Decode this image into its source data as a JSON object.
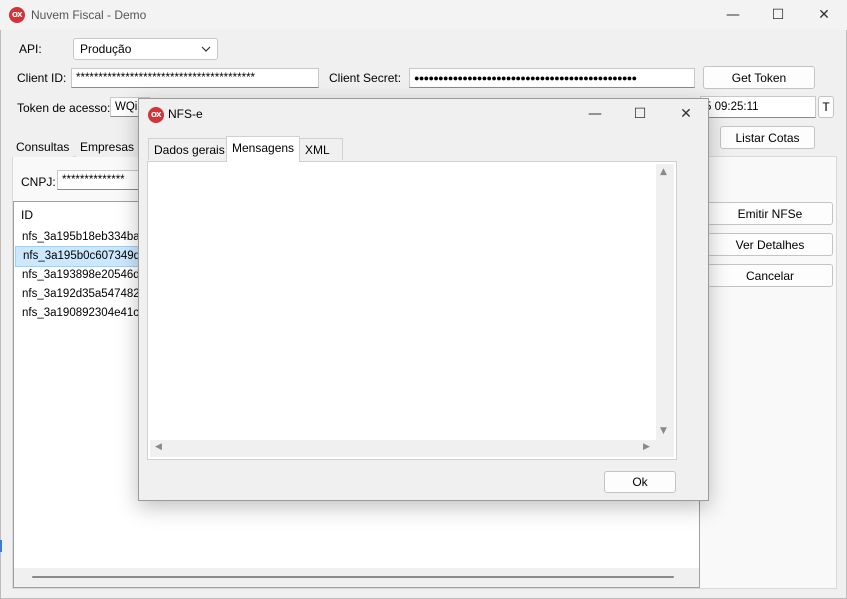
{
  "main_window": {
    "title": "Nuvem Fiscal - Demo",
    "app_icon": "OX",
    "controls": {
      "minimize": "—",
      "maximize": "☐",
      "close": "✕"
    }
  },
  "api": {
    "label": "API:",
    "selected": "Produção"
  },
  "credentials": {
    "client_id_label": "Client ID:",
    "client_id_value": "****************************************",
    "client_secret_label": "Client Secret:",
    "client_secret_value": "●●●●●●●●●●●●●●●●●●●●●●●●●●●●●●●●●●●●●●●●●●●●●●",
    "get_token_label": "Get Token"
  },
  "token": {
    "label": "Token de acesso:",
    "value_visible": "WQi",
    "expiry_visible": "5 09:25:11",
    "t_button": "T",
    "listar_cotas_label": "Listar Cotas"
  },
  "main_tabs": [
    "Consultas",
    "Empresas"
  ],
  "cnpj": {
    "label": "CNPJ:",
    "value": "**************"
  },
  "results": {
    "header": "ID",
    "rows": [
      "nfs_3a195b18eb334ba3",
      "nfs_3a195b0c607349dc",
      "nfs_3a193898e20546d1",
      "nfs_3a192d35a547482c",
      "nfs_3a190892304e41c3"
    ],
    "selected_index": 1
  },
  "side_buttons": {
    "emitir": "Emitir NFSe",
    "detalhes": "Ver Detalhes",
    "cancelar": "Cancelar"
  },
  "dialog": {
    "title": "NFS-e",
    "tabs": [
      "Dados gerais",
      "Mensagens",
      "XML"
    ],
    "active_tab": "Mensagens",
    "ok_label": "Ok"
  }
}
